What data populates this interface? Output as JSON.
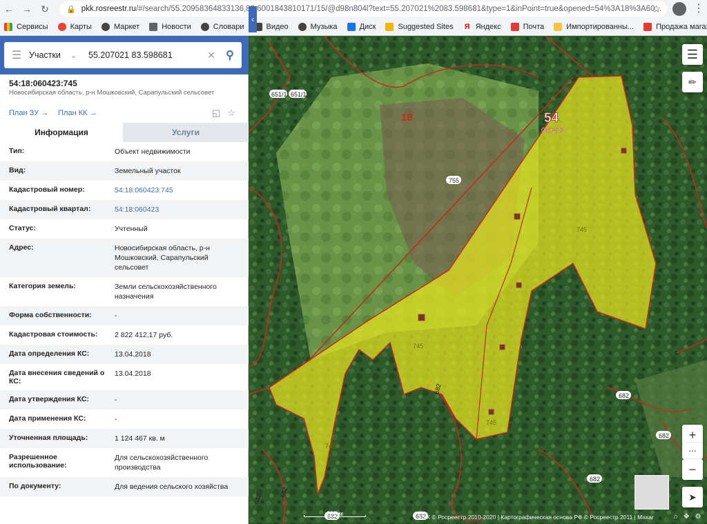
{
  "browser": {
    "url_host": "pkk.rosreestr.ru",
    "url_rest": "/#/search/55.20958364833136,83.6001843810171/15/@d98n804l?text=55.207021%2083.598681&type=1&inPoint=true&opened=54%3A18%3A60...",
    "bookmarks": [
      "Сервисы",
      "Карты",
      "Маркет",
      "Новости",
      "Словари",
      "Видео",
      "Музыка",
      "Диск",
      "Suggested Sites",
      "Яндекс",
      "Почта",
      "Импортированны...",
      "Продажа магазино..."
    ]
  },
  "search": {
    "type": "Участки",
    "query": "55.207021 83.598681"
  },
  "parcel": {
    "number": "54:18:060423:745",
    "location": "Новосибирская область, р-н Мошковский, Сарапульский сельсовет",
    "plan_zu": "План ЗУ →",
    "plan_kk": "План КК →"
  },
  "tabs": {
    "info": "Информация",
    "services": "Услуги"
  },
  "rows": [
    {
      "k": "Тип:",
      "v": "Объект недвижимости"
    },
    {
      "k": "Вид:",
      "v": "Земельный участок"
    },
    {
      "k": "Кадастровый номер:",
      "v": "54:18:060423:745"
    },
    {
      "k": "Кадастровый квартал:",
      "v": "54:18:060423"
    },
    {
      "k": "Статус:",
      "v": "Учтенный"
    },
    {
      "k": "Адрес:",
      "v": "Новосибирская область, р-н Мошковский, Сарапульский сельсовет"
    },
    {
      "k": "Категория земель:",
      "v": "Земли сельскохозяйственного назначения"
    },
    {
      "k": "Форма собственности:",
      "v": "-"
    },
    {
      "k": "Кадастровая стоимость:",
      "v": "2 822 412,17 руб."
    },
    {
      "k": "Дата определения КС:",
      "v": "13.04.2018"
    },
    {
      "k": "Дата внесения сведений о КС:",
      "v": "13.04.2018"
    },
    {
      "k": "Дата утверждения КС:",
      "v": "-"
    },
    {
      "k": "Дата применения КС:",
      "v": "-"
    },
    {
      "k": "Уточненная площадь:",
      "v": "1 124 467 кв. м"
    },
    {
      "k": "Разрешенное использование:",
      "v": "Для сельскохозяйственного производства"
    },
    {
      "k": "По документу:",
      "v": "Для ведения сельского хозяйства"
    }
  ],
  "map": {
    "labels": {
      "l651a": "651/1",
      "l651b": "651/1",
      "l18": "18",
      "l54": "54",
      "quarter": "060423",
      "p755": "755",
      "p745a": "745",
      "p745b": "745",
      "p745c": "745",
      "p745d": "745",
      "p682a": "682",
      "p682b": "682",
      "p682c": "682",
      "p682d": "682",
      "p682e": "682",
      "p682f": "682",
      "p682g": "682",
      "p682h": "682"
    },
    "scale": "200 м",
    "copyright": "ПКК © Росреестр 2010-2020 | Картографическая основа РФ © Росреестр 2011 | Maxar"
  },
  "colors": {
    "header_blue": "#3d6ab8",
    "parcel_fill": "#e6e61e",
    "boundary": "#c8281e"
  }
}
